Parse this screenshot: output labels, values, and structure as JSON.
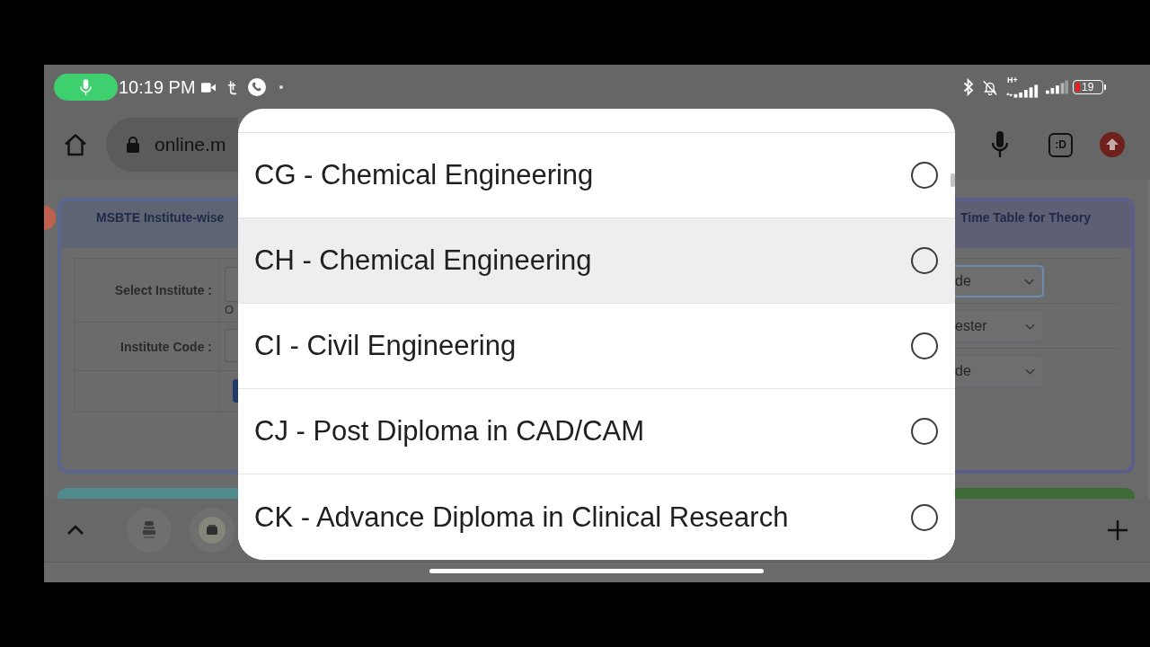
{
  "status_bar": {
    "time": "10:19 PM",
    "network_type": "H+",
    "battery_percent": "19"
  },
  "browser_toolbar": {
    "url": "online.m",
    "extension_label": ":D"
  },
  "page": {
    "left_card": {
      "title": "MSBTE Institute-wise",
      "fields": [
        {
          "label": "Select Institute :"
        },
        {
          "label": "Institute Code :"
        }
      ],
      "separator_text": "O"
    },
    "right_card": {
      "title": "Time Table for Theory",
      "selects": [
        {
          "value": "de",
          "focused": true
        },
        {
          "value": "ester",
          "focused": false
        },
        {
          "value": "de",
          "focused": false
        }
      ]
    }
  },
  "dialog": {
    "options": [
      {
        "label": "CG - Chemical Engineering",
        "highlighted": false,
        "selected": false
      },
      {
        "label": "CH - Chemical Engineering",
        "highlighted": true,
        "selected": false
      },
      {
        "label": "CI - Civil Engineering",
        "highlighted": false,
        "selected": false
      },
      {
        "label": "CJ - Post Diploma in CAD/CAM",
        "highlighted": false,
        "selected": false
      },
      {
        "label": "CK - Advance Diploma in Clinical Research",
        "highlighted": false,
        "selected": false
      }
    ]
  }
}
